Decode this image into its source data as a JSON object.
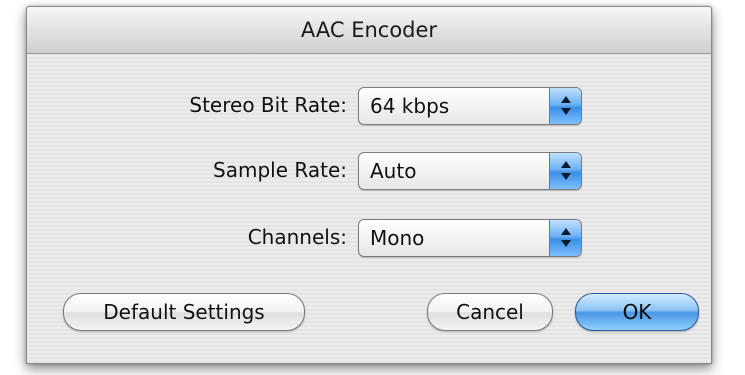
{
  "window": {
    "title": "AAC Encoder"
  },
  "fields": [
    {
      "label": "Stereo Bit Rate:",
      "value": "64 kbps"
    },
    {
      "label": "Sample Rate:",
      "value": "Auto"
    },
    {
      "label": "Channels:",
      "value": "Mono"
    }
  ],
  "buttons": {
    "default_settings": "Default Settings",
    "cancel": "Cancel",
    "ok": "OK"
  },
  "colors": {
    "accent": "#4a97e6",
    "window_bg": "#ececec"
  },
  "icons": {
    "popup_arrows": "updown-arrows-icon"
  }
}
